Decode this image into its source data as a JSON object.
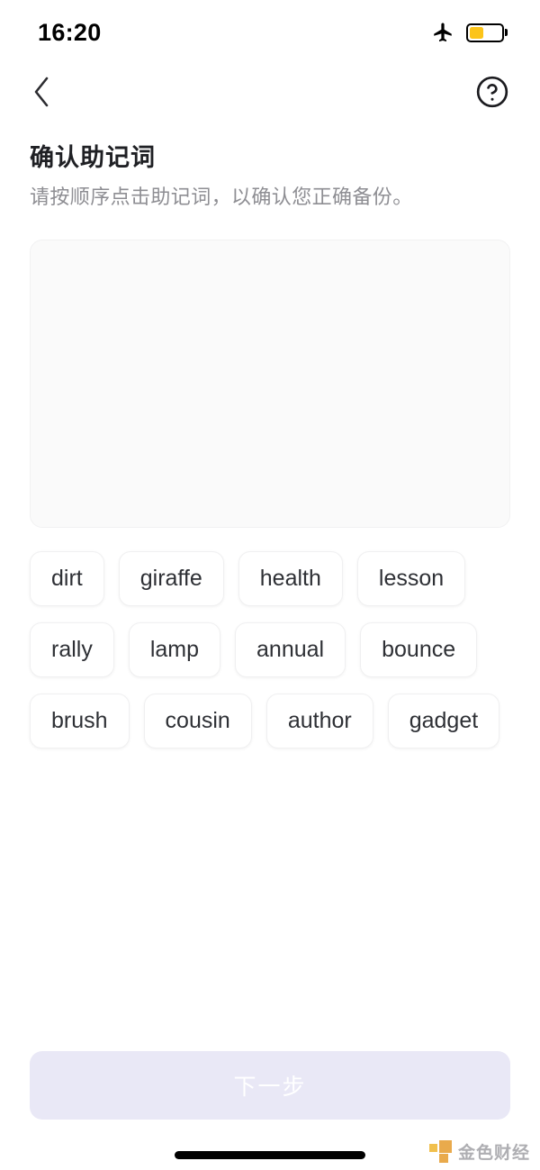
{
  "status_bar": {
    "time": "16:20",
    "airplane_icon": "airplane-mode-icon",
    "battery_icon": "battery-low-power-icon",
    "battery_level_percent": 45,
    "battery_color": "#fcc419"
  },
  "nav": {
    "back_icon": "chevron-left-icon",
    "help_icon": "question-mark-circle-icon"
  },
  "heading": {
    "title": "确认助记词",
    "subtitle": "请按顺序点击助记词，以确认您正确备份。"
  },
  "answer_area": {
    "selected_words": [],
    "background_color": "#fafafa"
  },
  "word_pool": {
    "words": [
      "dirt",
      "giraffe",
      "health",
      "lesson",
      "rally",
      "lamp",
      "annual",
      "bounce",
      "brush",
      "cousin",
      "author",
      "gadget"
    ]
  },
  "footer": {
    "next_label": "下一步",
    "next_enabled": false,
    "next_background_color": "#e9e8f6",
    "next_text_color": "#ffffff"
  },
  "watermark": {
    "text": "金色财经",
    "logo_color": "#e8a33d"
  }
}
